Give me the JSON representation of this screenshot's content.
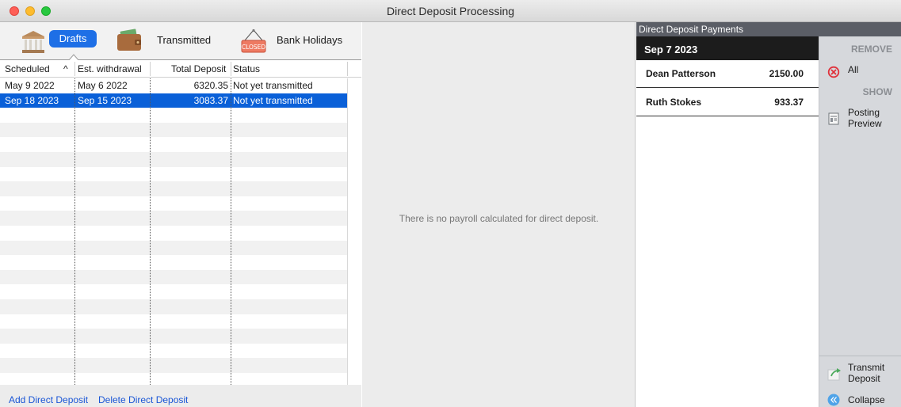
{
  "window": {
    "title": "Direct Deposit Processing"
  },
  "tabs": {
    "drafts_label": "Drafts",
    "transmitted_label": "Transmitted",
    "holidays_label": "Bank Holidays",
    "closed_sign_text": "CLOSED"
  },
  "table": {
    "headers": {
      "scheduled": "Scheduled",
      "sort_indicator": "^",
      "est_withdrawal": "Est. withdrawal",
      "total_deposit": "Total Deposit",
      "status": "Status"
    },
    "rows": [
      {
        "scheduled": "May 9 2022",
        "est_withdrawal": "May 6 2022",
        "total_deposit": "6320.35",
        "status": "Not yet transmitted",
        "selected": false
      },
      {
        "scheduled": "Sep 18 2023",
        "est_withdrawal": "Sep 15 2023",
        "total_deposit": "3083.37",
        "status": "Not yet transmitted",
        "selected": true
      }
    ]
  },
  "footer": {
    "add_label": "Add Direct Deposit",
    "delete_label": "Delete Direct Deposit"
  },
  "middle": {
    "empty_message": "There is no payroll calculated for direct deposit."
  },
  "payments": {
    "header": "Direct Deposit Payments",
    "date": "Sep 7 2023",
    "items": [
      {
        "name": "Dean Patterson",
        "amount": "2150.00"
      },
      {
        "name": "Ruth Stokes",
        "amount": "933.37"
      }
    ]
  },
  "sidebar": {
    "remove_title": "REMOVE",
    "all_label": "All",
    "show_title": "SHOW",
    "posting_line1": "Posting",
    "posting_line2": "Preview",
    "transmit_line1": "Transmit",
    "transmit_line2": "Deposit",
    "collapse_label": "Collapse"
  },
  "colors": {
    "accent": "#1e6fe6",
    "selection": "#0a60d8",
    "link": "#1a56d6",
    "remove_icon": "#e0303a"
  }
}
